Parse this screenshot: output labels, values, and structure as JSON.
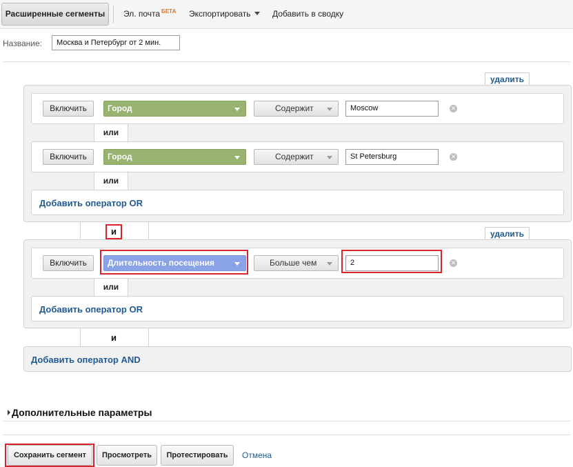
{
  "toolbar": {
    "advanced_segments": "Расширенные сегменты",
    "email": "Эл. почта",
    "email_badge": "БЕТА",
    "export": "Экспортировать",
    "add_to_dashboard": "Добавить в сводку"
  },
  "segment": {
    "name_label": "Название:",
    "name_value": "Москва и Петербург от 2 мин."
  },
  "groups": [
    {
      "delete_label": "удалить",
      "conditions": [
        {
          "include": "Включить",
          "dimension": "Город",
          "operator": "Содержит",
          "value": "Moscow"
        },
        {
          "include": "Включить",
          "dimension": "Город",
          "operator": "Содержит",
          "value": "St Petersburg"
        }
      ],
      "or_labels": [
        "или",
        "или"
      ],
      "add_or": "Добавить оператор OR"
    },
    {
      "delete_label": "удалить",
      "conditions": [
        {
          "include": "Включить",
          "dimension": "Длительность посещения",
          "operator": "Больше чем",
          "value": "2"
        }
      ],
      "or_labels": [
        "или"
      ],
      "add_or": "Добавить оператор OR"
    }
  ],
  "and_labels": [
    "и",
    "и"
  ],
  "add_and": "Добавить оператор AND",
  "advanced": {
    "title": "Дополнительные параметры"
  },
  "actions": {
    "save": "Сохранить сегмент",
    "preview": "Просмотреть",
    "test": "Протестировать",
    "cancel": "Отмена"
  },
  "colors": {
    "dimension_green": "#97b36f",
    "metric_blue": "#8aa3e6",
    "link_blue": "#1f5a94",
    "highlight_red": "#d9232b",
    "beta_orange": "#e07020"
  }
}
